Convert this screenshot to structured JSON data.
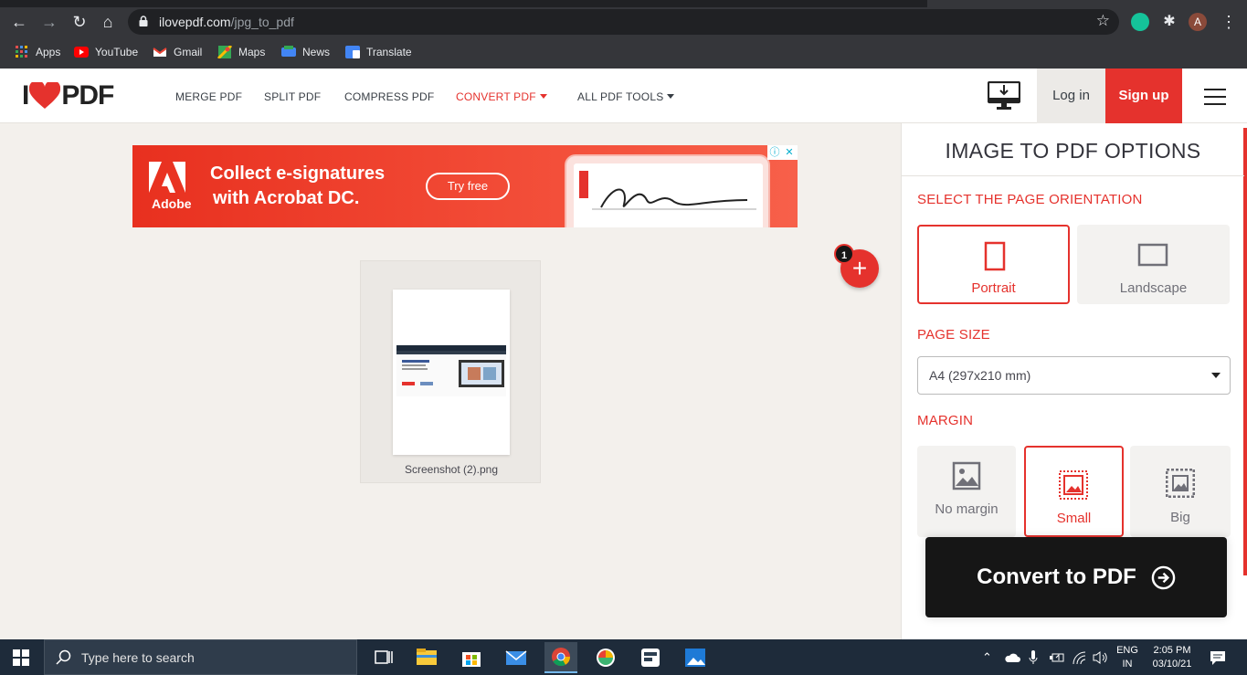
{
  "browser": {
    "url_host": "ilovepdf.com",
    "url_path": "/jpg_to_pdf",
    "profile_initial": "A",
    "bookmarks": [
      "Apps",
      "YouTube",
      "Gmail",
      "Maps",
      "News",
      "Translate"
    ]
  },
  "site": {
    "logo_text": "PDF",
    "nav": [
      "MERGE PDF",
      "SPLIT PDF",
      "COMPRESS PDF",
      "CONVERT PDF",
      "ALL PDF TOOLS"
    ],
    "login": "Log in",
    "signup": "Sign up",
    "brand_color": "#e5322d"
  },
  "ad": {
    "brand": "Adobe",
    "line1": "Collect e-signatures",
    "line2": "with Acrobat DC.",
    "cta": "Try free"
  },
  "workspace": {
    "file_name": "Screenshot (2).png",
    "file_count": "1"
  },
  "sidebar": {
    "title": "IMAGE TO PDF OPTIONS",
    "orientation_label": "SELECT THE PAGE ORIENTATION",
    "orientation": [
      {
        "label": "Portrait",
        "selected": true
      },
      {
        "label": "Landscape",
        "selected": false
      }
    ],
    "page_size_label": "PAGE SIZE",
    "page_size_value": "A4 (297x210 mm)",
    "margin_label": "MARGIN",
    "margins": [
      {
        "label": "No margin",
        "selected": false
      },
      {
        "label": "Small",
        "selected": true
      },
      {
        "label": "Big",
        "selected": false
      }
    ],
    "convert_label": "Convert to PDF"
  },
  "taskbar": {
    "search_placeholder": "Type here to search",
    "lang": "ENG",
    "region": "IN",
    "time": "2:05 PM",
    "date": "03/10/21"
  }
}
